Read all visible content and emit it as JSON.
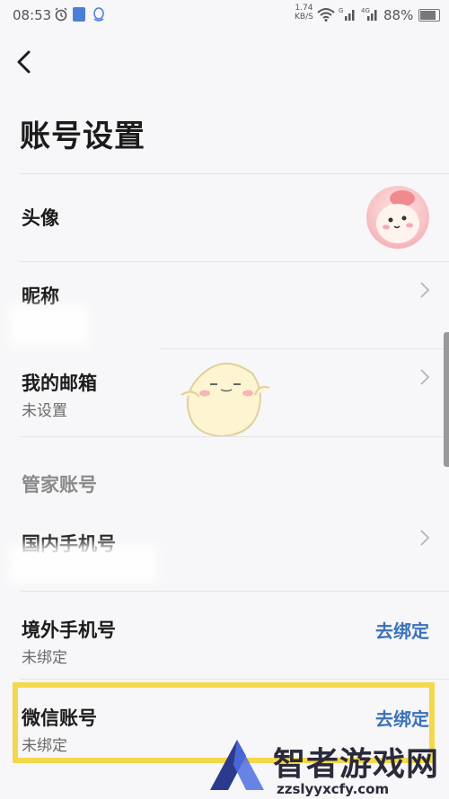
{
  "status_bar": {
    "time": "08:53",
    "net_speed_value": "1.74",
    "net_speed_unit": "KB/S",
    "signal_1_tag": "G",
    "signal_2_tag": "4G",
    "battery_percent": "88%",
    "battery_level": 0.88
  },
  "page": {
    "title": "账号设置"
  },
  "rows": {
    "avatar": {
      "label": "头像"
    },
    "nickname": {
      "label": "昵称"
    },
    "email": {
      "label": "我的邮箱",
      "sub": "未设置"
    },
    "section_manager": {
      "label": "管家账号"
    },
    "domestic_phone": {
      "label": "国内手机号"
    },
    "overseas_phone": {
      "label": "境外手机号",
      "sub": "未绑定",
      "action": "去绑定"
    },
    "wechat": {
      "label": "微信账号",
      "sub": "未绑定",
      "action": "去绑定"
    }
  },
  "watermark": {
    "brand": "智者游戏网",
    "url": "zzslyyxcfy.com"
  },
  "colors": {
    "accent": "#3a72b8",
    "highlight": "#f5d84a",
    "background": "#f7f6f8"
  }
}
